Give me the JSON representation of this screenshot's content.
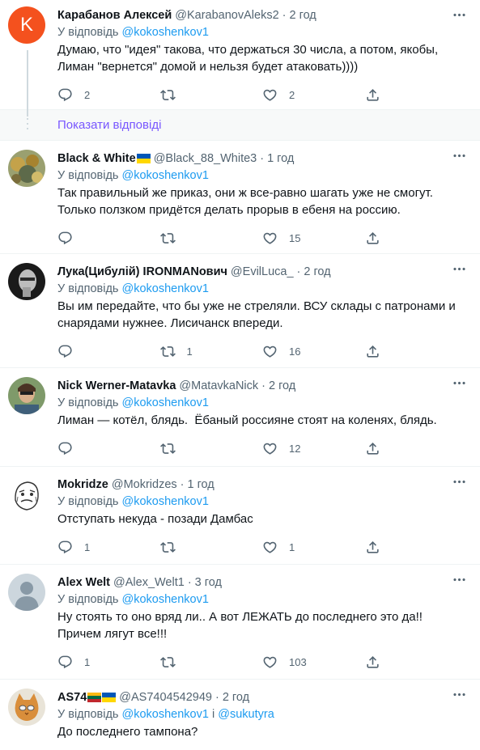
{
  "show_replies_label": "Показати відповіді",
  "colors": {
    "accent": "#1d9bf0",
    "show_replies": "#7856ff",
    "avatar_k": "#f4511e"
  },
  "tweets": [
    {
      "name": "Карабанов Алексей",
      "handle": "@KarabanovAleks2",
      "time": "2 год",
      "reply_prefix": "У відповідь",
      "reply_to": "@kokoshenkov1",
      "text": "Думаю, что \"идея\" такова, что держаться 30 числа, а потом, якобы, Лиман \"вернется\" домой и нельзя будет атаковать))))",
      "avatar_letter": "K",
      "avatar_icon": "letter-avatar",
      "replies": "2",
      "retweets": "",
      "likes": "2"
    },
    {
      "name": "Black & White",
      "handle": "@Black_88_White3",
      "time": "1 год",
      "reply_prefix": "У відповідь",
      "reply_to": "@kokoshenkov1",
      "text": "Так правильный же приказ, они ж все-равно шагать уже не смогут. Только ползком придётся делать прорыв в ебеня на россию.",
      "avatar_icon": "photo-avatar",
      "replies": "",
      "retweets": "",
      "likes": "15"
    },
    {
      "name": "Лука(Цибулій) IRONMANович",
      "handle": "@EvilLuca_",
      "time": "2 год",
      "reply_prefix": "У відповідь",
      "reply_to": "@kokoshenkov1",
      "text": "Вы им передайте, что бы уже не стреляли. ВСУ склады с патронами и снарядами нужнее. Лисичанск впереди.",
      "avatar_icon": "photo-avatar",
      "replies": "",
      "retweets": "1",
      "likes": "16"
    },
    {
      "name": "Nick Werner-Matavka",
      "handle": "@MatavkaNick",
      "time": "2 год",
      "reply_prefix": "У відповідь",
      "reply_to": "@kokoshenkov1",
      "text": "Лиман — котёл, блядь.  Ёбаный россияне стоят на коленях, блядь.",
      "avatar_icon": "photo-avatar",
      "replies": "",
      "retweets": "",
      "likes": "12"
    },
    {
      "name": "Mokridze",
      "handle": "@Mokridzes",
      "time": "1 год",
      "reply_prefix": "У відповідь",
      "reply_to": "@kokoshenkov1",
      "text": "Отступать некуда - позади Дамбас",
      "avatar_icon": "meme-face-avatar",
      "replies": "1",
      "retweets": "",
      "likes": "1"
    },
    {
      "name": "Alex Welt",
      "handle": "@Alex_Welt1",
      "time": "3 год",
      "reply_prefix": "У відповідь",
      "reply_to": "@kokoshenkov1",
      "text": "Ну стоять то оно вряд ли.. А вот ЛЕЖАТЬ до последнего это да!! Причем лягут все!!!",
      "avatar_icon": "default-user-avatar",
      "replies": "1",
      "retweets": "",
      "likes": "103"
    },
    {
      "name": "AS74",
      "handle": "@AS7404542949",
      "time": "2 год",
      "reply_prefix": "У відповідь",
      "reply_to": "@kokoshenkov1",
      "reply_and": "і",
      "reply_to_2": "@sukutyra",
      "text": "До последнего тампона?",
      "avatar_icon": "cat-avatar"
    }
  ]
}
